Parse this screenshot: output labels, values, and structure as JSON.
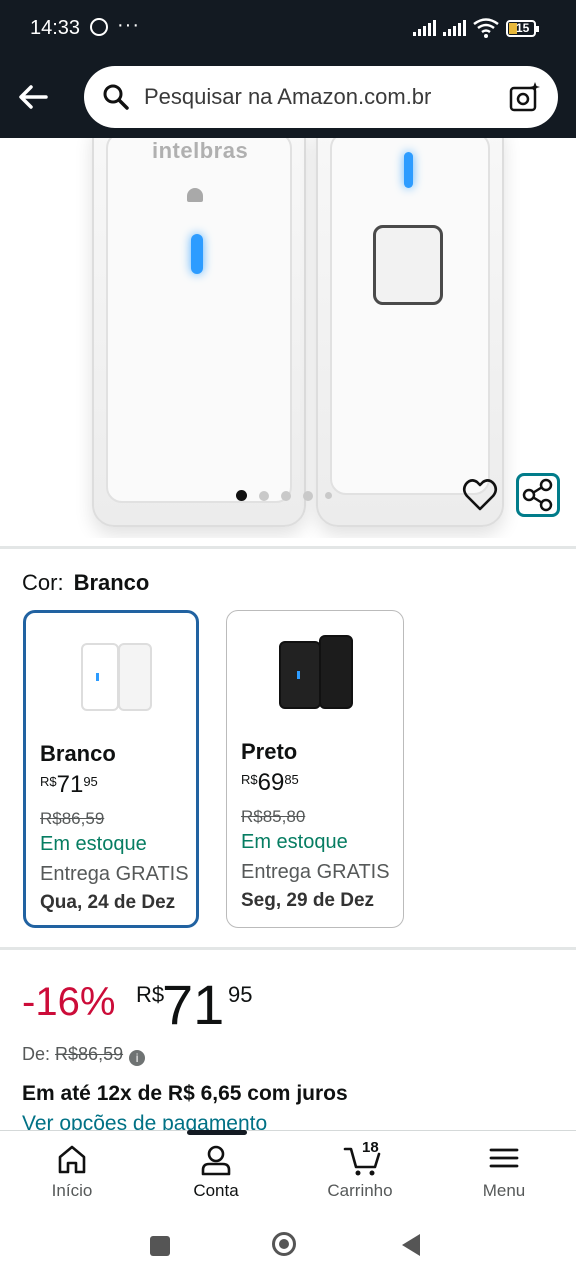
{
  "status_bar": {
    "time": "14:33",
    "more": "···",
    "battery": "15"
  },
  "search": {
    "placeholder": "Pesquisar na Amazon.com.br"
  },
  "product_image": {
    "brand": "intelbras",
    "dots_total": 5,
    "active_dot": 1
  },
  "color_selector": {
    "label": "Cor:",
    "selected": "Branco",
    "options": [
      {
        "name": "Branco",
        "currency": "R$",
        "price_int": "71",
        "price_cents": "95",
        "old_price": "R$86,59",
        "stock": "Em estoque",
        "delivery": "Entrega GRATIS",
        "date": "Qua, 24 de Dez"
      },
      {
        "name": "Preto",
        "currency": "R$",
        "price_int": "69",
        "price_cents": "85",
        "old_price": "R$85,80",
        "stock": "Em estoque",
        "delivery": "Entrega GRATIS",
        "date": "Seg, 29 de Dez"
      }
    ]
  },
  "price": {
    "discount": "-16%",
    "currency": "R$",
    "int": "71",
    "cents": "95",
    "de_label": "De:",
    "de_value": "R$86,59",
    "info_icon": "i",
    "installments": "Em até 12x de R$ 6,65 com juros",
    "payment_link": "Ver opções de pagamento"
  },
  "bottom_nav": {
    "items": [
      {
        "label": "Início",
        "icon": "home-icon"
      },
      {
        "label": "Conta",
        "icon": "user-icon"
      },
      {
        "label": "Carrinho",
        "icon": "cart-icon",
        "count": "18"
      },
      {
        "label": "Menu",
        "icon": "menu-icon"
      }
    ],
    "active": "Conta"
  },
  "colors": {
    "header_bg": "#131a22",
    "accent": "#2162a1",
    "deal": "#cc0c39",
    "stock": "#067d62",
    "link": "#007185"
  }
}
